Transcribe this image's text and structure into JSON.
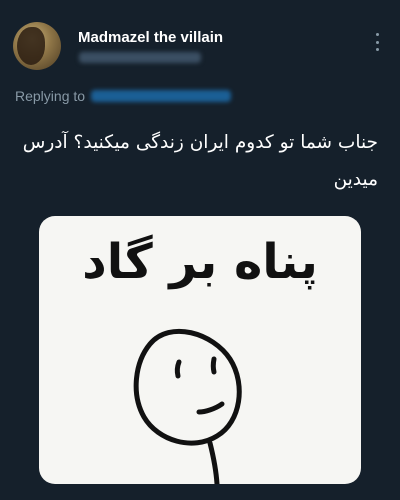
{
  "tweet": {
    "author_name": "Madmazel the villain",
    "replying_label": "Replying to",
    "text": "جناب شما تو کدوم ایران زندگی میکنید؟ آدرس میدین",
    "menu_icon": "more-vertical-icon"
  },
  "media": {
    "caption": "پناه بر گاد",
    "drawing_icon": "stick-figure-face-icon"
  },
  "colors": {
    "background": "#15202b",
    "muted": "#8899a6",
    "link": "#1d9bf0",
    "media_bg": "#f6f6f3"
  }
}
